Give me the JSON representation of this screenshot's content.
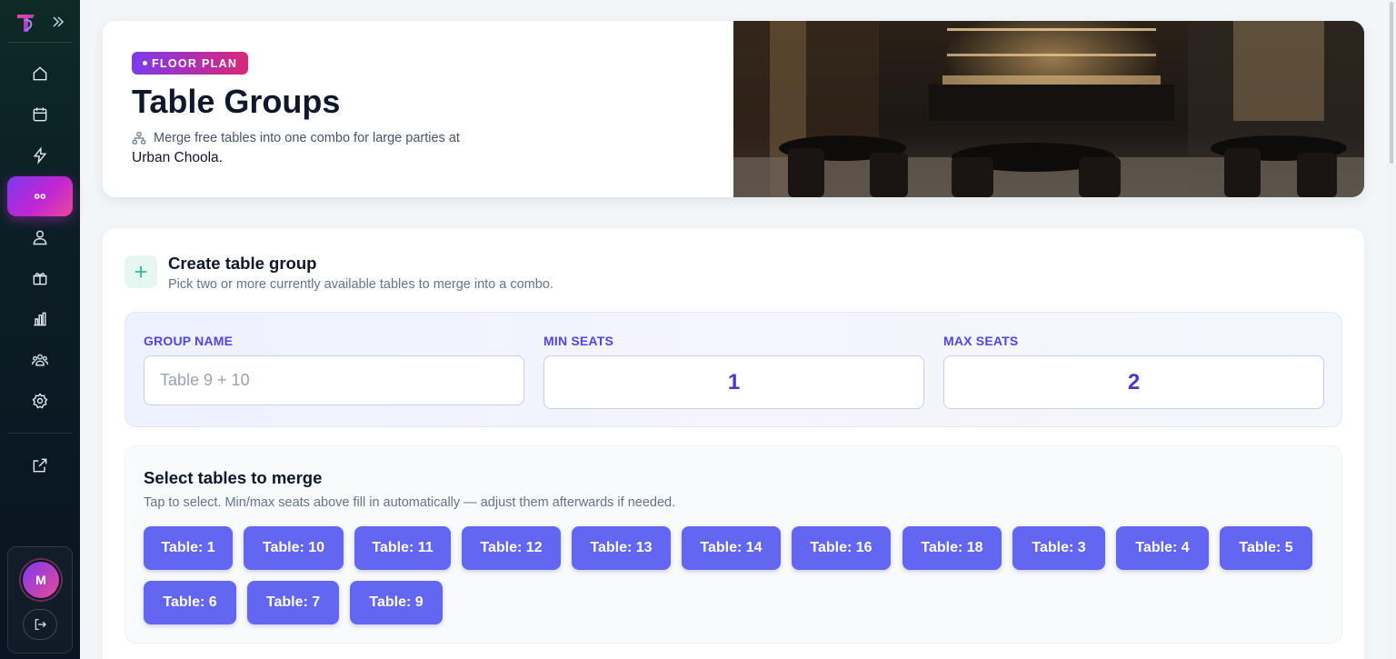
{
  "sidebar": {
    "items": [
      {
        "name": "home-icon",
        "active": false
      },
      {
        "name": "calendar-icon",
        "active": false
      },
      {
        "name": "lightning-icon",
        "active": false
      },
      {
        "name": "table-groups-icon",
        "active": true
      },
      {
        "name": "user-icon",
        "active": false
      },
      {
        "name": "gift-icon",
        "active": false
      },
      {
        "name": "bar-chart-icon",
        "active": false
      },
      {
        "name": "team-icon",
        "active": false
      },
      {
        "name": "settings-icon",
        "active": false
      },
      {
        "name": "external-link-icon",
        "active": false
      }
    ],
    "avatar_initial": "M"
  },
  "hero": {
    "badge": "FLOOR PLAN",
    "title": "Table Groups",
    "subtitle": "Merge free tables into one combo for large parties at",
    "venue": "Urban Choola",
    "venue_suffix": "."
  },
  "create": {
    "title": "Create table group",
    "subtitle": "Pick two or more currently available tables to merge into a combo."
  },
  "form": {
    "group_name_label": "GROUP NAME",
    "group_name_placeholder": "Table 9 + 10",
    "group_name_value": "",
    "min_seats_label": "MIN SEATS",
    "min_seats_value": "1",
    "max_seats_label": "MAX SEATS",
    "max_seats_value": "2"
  },
  "select": {
    "title": "Select tables to merge",
    "subtitle": "Tap to select. Min/max seats above fill in automatically — adjust them afterwards if needed.",
    "tables": [
      "Table: 1",
      "Table: 10",
      "Table: 11",
      "Table: 12",
      "Table: 13",
      "Table: 14",
      "Table: 16",
      "Table: 18",
      "Table: 3",
      "Table: 4",
      "Table: 5",
      "Table: 6",
      "Table: 7",
      "Table: 9"
    ]
  },
  "colors": {
    "accent": "#6366f1",
    "brand_gradient_start": "#7c3aed",
    "brand_gradient_end": "#ec4899",
    "sidebar_bg": "#0b1d24"
  }
}
